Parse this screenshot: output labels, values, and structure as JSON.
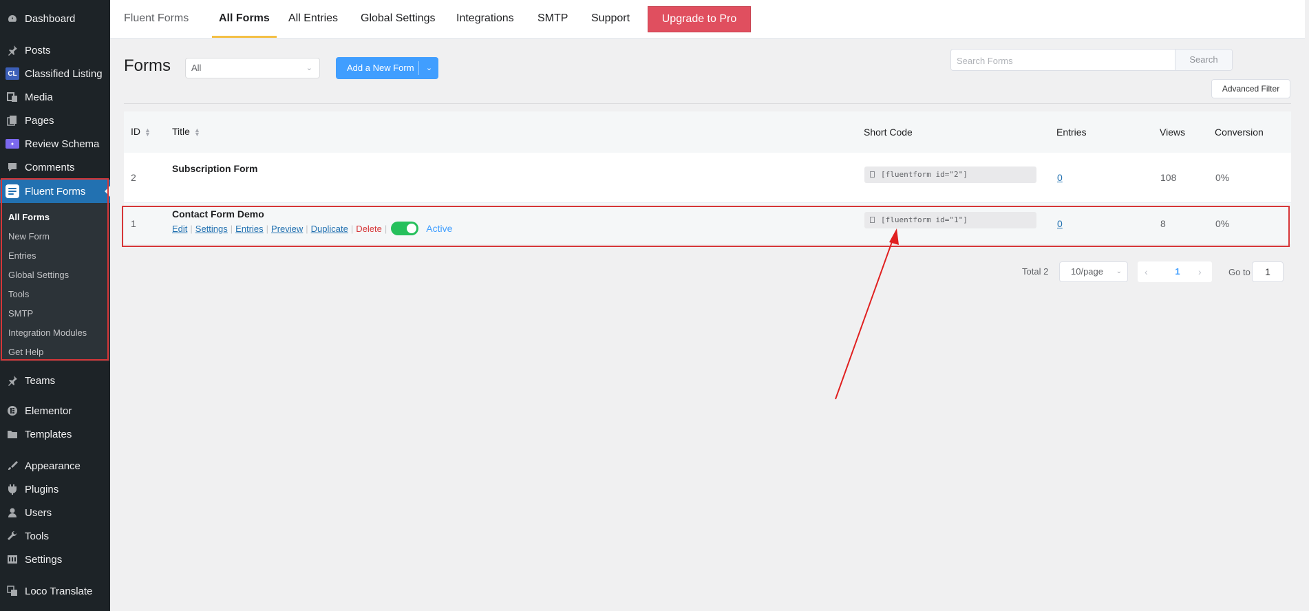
{
  "sidebar": {
    "items": [
      {
        "label": "Dashboard",
        "icon": "dashboard-icon"
      },
      {
        "label": "Posts",
        "icon": "pin-icon"
      },
      {
        "label": "Classified Listing",
        "icon": "cl-badge-icon",
        "badge": "CL"
      },
      {
        "label": "Media",
        "icon": "media-icon"
      },
      {
        "label": "Pages",
        "icon": "pages-icon"
      },
      {
        "label": "Review Schema",
        "icon": "review-schema-icon"
      },
      {
        "label": "Comments",
        "icon": "comment-icon"
      },
      {
        "label": "Fluent Forms",
        "icon": "fluent-forms-icon"
      },
      {
        "label": "Teams",
        "icon": "pin-icon"
      },
      {
        "label": "Elementor",
        "icon": "elementor-icon"
      },
      {
        "label": "Templates",
        "icon": "folder-icon"
      },
      {
        "label": "Appearance",
        "icon": "brush-icon"
      },
      {
        "label": "Plugins",
        "icon": "plugin-icon"
      },
      {
        "label": "Users",
        "icon": "user-icon"
      },
      {
        "label": "Tools",
        "icon": "wrench-icon"
      },
      {
        "label": "Settings",
        "icon": "settings-icon"
      },
      {
        "label": "Loco Translate",
        "icon": "translate-icon"
      }
    ],
    "submenu": [
      "All Forms",
      "New Form",
      "Entries",
      "Global Settings",
      "Tools",
      "SMTP",
      "Integration Modules",
      "Get Help"
    ]
  },
  "topnav": {
    "brand": "Fluent Forms",
    "links": [
      "All Forms",
      "All Entries",
      "Global Settings",
      "Integrations",
      "SMTP",
      "Support"
    ],
    "upgrade": "Upgrade to Pro"
  },
  "header": {
    "title": "Forms",
    "status_filter": "All",
    "add_button": "Add a New Form",
    "search_placeholder": "Search Forms",
    "search_button": "Search",
    "advanced_filter": "Advanced Filter"
  },
  "table": {
    "columns": [
      "ID",
      "Title",
      "Short Code",
      "Entries",
      "Views",
      "Conversion"
    ],
    "rows": [
      {
        "id": "2",
        "title": "Subscription Form",
        "shortcode": "[fluentform id=\"2\"]",
        "entries": "0",
        "views": "108",
        "conversion": "0%"
      },
      {
        "id": "1",
        "title": "Contact Form Demo",
        "shortcode": "[fluentform id=\"1\"]",
        "entries": "0",
        "views": "8",
        "conversion": "0%"
      }
    ],
    "row_actions": [
      "Edit",
      "Settings",
      "Entries",
      "Preview",
      "Duplicate",
      "Delete"
    ],
    "status": "Active"
  },
  "pagination": {
    "total": "Total 2",
    "per_page": "10/page",
    "current_page": "1",
    "goto_label": "Go to",
    "goto_value": "1"
  },
  "colors": {
    "sidebar_bg": "#1d2327",
    "wp_blue": "#2271b1",
    "upgrade_red": "#e04f5f",
    "primary_blue": "#409eff",
    "toggle_green": "#26c05c",
    "highlight_red": "#d63638"
  }
}
